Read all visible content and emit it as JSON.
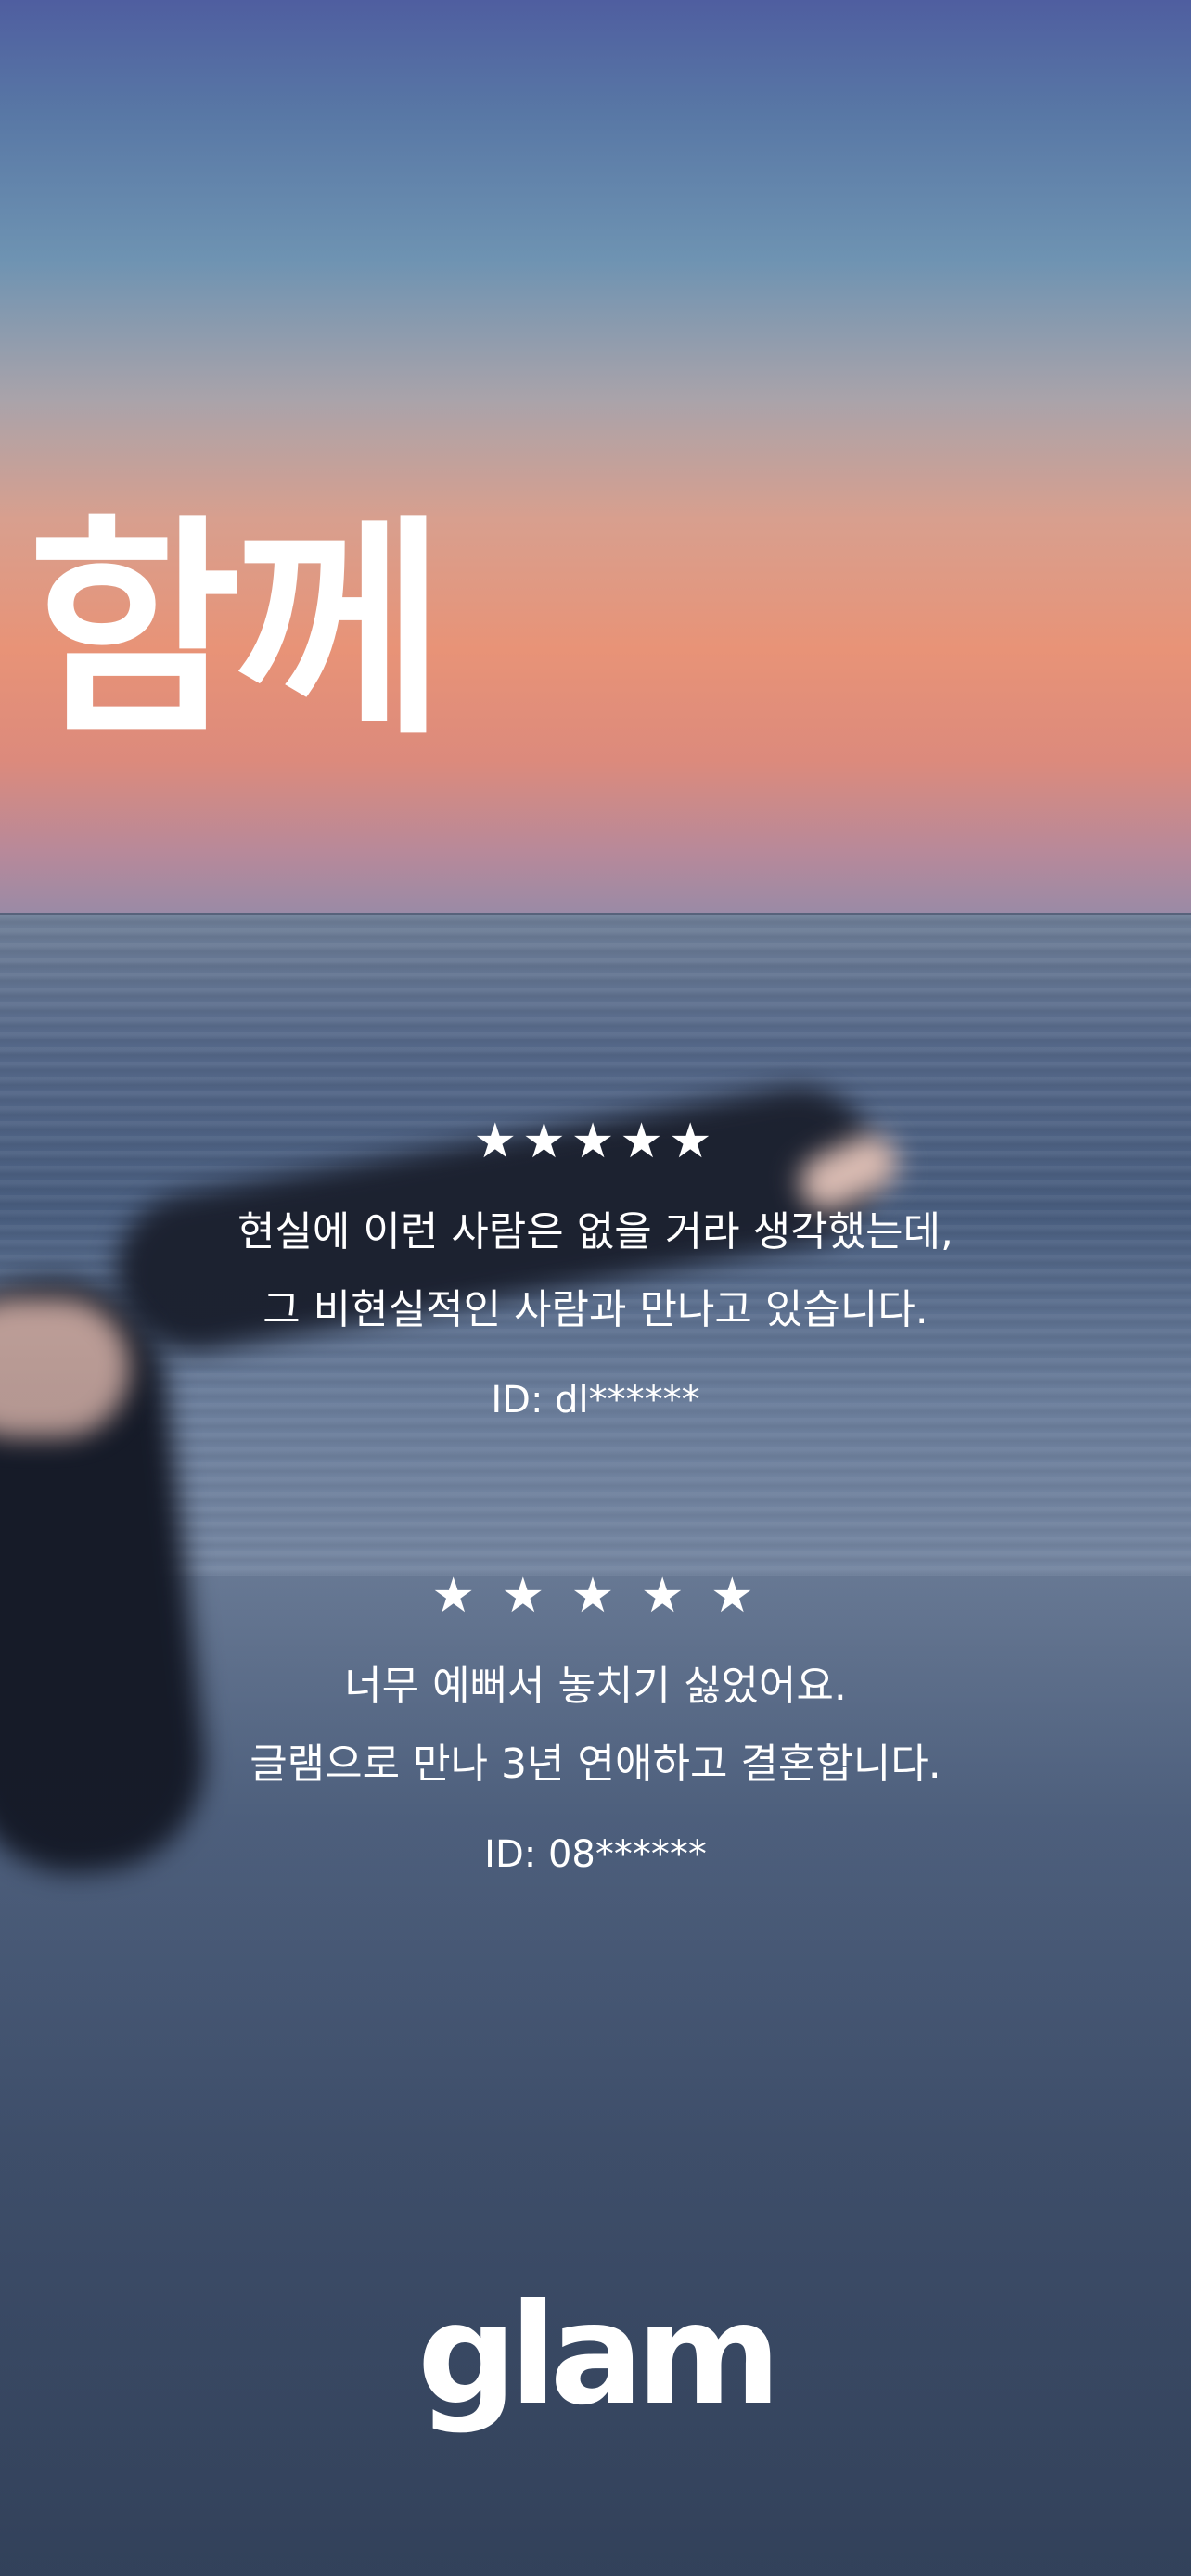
{
  "headline": "함께",
  "reviews": [
    {
      "stars": "★★★★★",
      "lines": [
        "현실에 이런 사람은 없을 거라 생각했는데,",
        "그 비현실적인 사람과 만나고 있습니다."
      ],
      "id": "ID: dl******"
    },
    {
      "stars": "★ ★ ★ ★ ★",
      "lines": [
        "너무 예뻐서 놓치기 싫었어요.",
        "글램으로  만나 3년 연애하고 결혼합니다."
      ],
      "id": "ID: 08******"
    }
  ],
  "rating": 5,
  "brand": {
    "logo_text": "glam"
  },
  "background": {
    "scene": "sunset ocean beach with outstretched arm"
  },
  "colors": {
    "text": "#ffffff",
    "sky_top": "#4f5ea0",
    "sunset": "#e89377",
    "sea": "#56698a"
  },
  "icons": [
    "star-icon"
  ]
}
